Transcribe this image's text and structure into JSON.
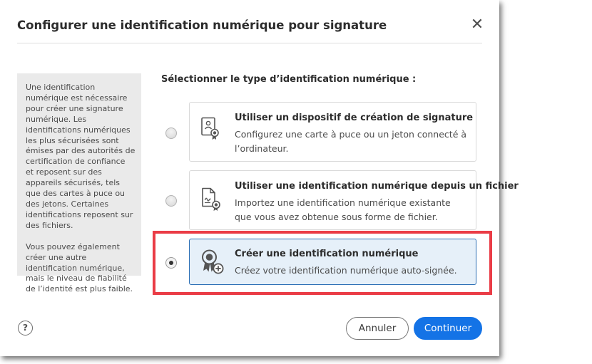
{
  "dialog": {
    "title": "Configurer une identification numérique pour signature",
    "close_glyph": "✕"
  },
  "info_panel": {
    "paragraph_1": "Une identification numérique est nécessaire pour créer une signature numérique. Les identifications numériques les plus sécurisées sont émises par des autorités de certification de confiance et reposent sur des appareils sécurisés, tels que des cartes à puce ou des jetons. Certaines identifications reposent sur des fichiers.",
    "paragraph_2": "Vous pouvez également créer une autre identification numérique, mais le niveau de fiabilité de l’identité est plus faible."
  },
  "selection": {
    "label": "Sélectionner le type d’identification numérique :",
    "options": [
      {
        "title": "Utiliser un dispositif de création de signature",
        "description": "Configurez une carte à puce ou un jeton connecté à l’ordinateur.",
        "icon": "id-card-badge-icon",
        "selected": false
      },
      {
        "title": "Utiliser une identification numérique depuis un fichier",
        "description": "Importez une identification numérique existante que vous avez obtenue sous forme de fichier.",
        "icon": "signed-file-icon",
        "selected": false
      },
      {
        "title": "Créer une identification numérique",
        "description": "Créez votre identification numérique auto-signée.",
        "icon": "award-ribbon-plus-icon",
        "selected": true
      }
    ]
  },
  "footer": {
    "help_glyph": "?",
    "cancel_label": "Annuler",
    "continue_label": "Continuer"
  },
  "colors": {
    "primary_button": "#1473e6",
    "selected_card_bg": "#e6f0f9",
    "selected_card_border": "#2c6fb5",
    "highlight_box": "#ea3c46"
  }
}
